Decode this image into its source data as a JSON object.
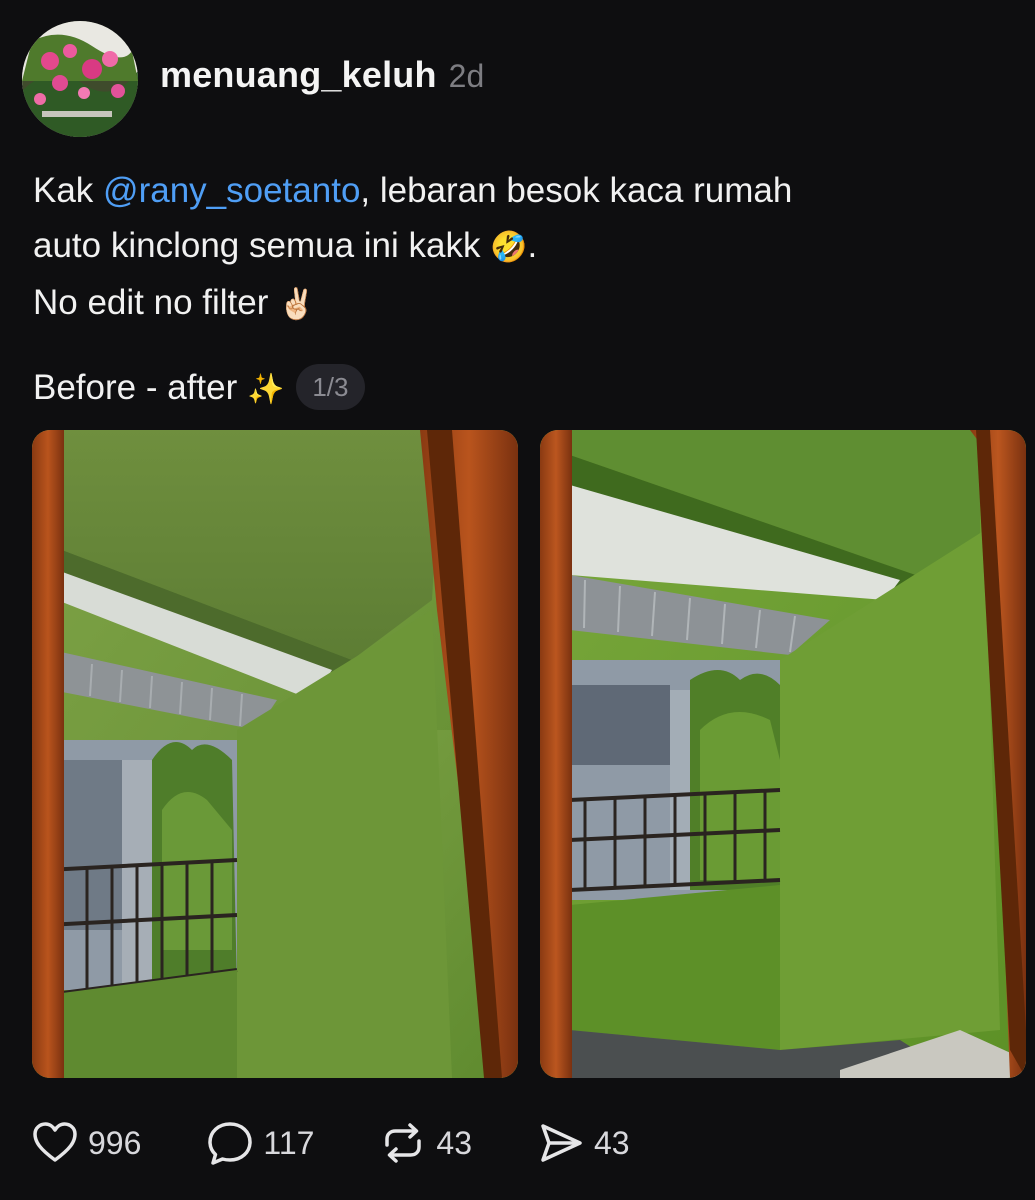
{
  "post": {
    "username": "menuang_keluh",
    "time": "2d",
    "caption": {
      "line1_prefix": "Kak ",
      "mention": "@rany_soetanto",
      "line1_suffix": ", lebaran besok kaca rumah",
      "line2": "auto kinclong semua ini kakk ",
      "line2_emoji": "🤣",
      "line2_end": ".",
      "line3": "No edit no filter ",
      "line3_emoji": "✌🏻",
      "line4": "Before - after ",
      "line4_emoji": "✨"
    },
    "media_counter": "1/3"
  },
  "actions": {
    "likes": "996",
    "comments": "117",
    "reposts": "43",
    "shares": "43"
  },
  "icons": {
    "like": "heart-icon",
    "comment": "comment-bubble-icon",
    "repost": "repost-icon",
    "share": "send-icon"
  },
  "colors": {
    "background": "#0e0e10",
    "mention": "#4f9ef5",
    "muted": "#7d7d82"
  }
}
